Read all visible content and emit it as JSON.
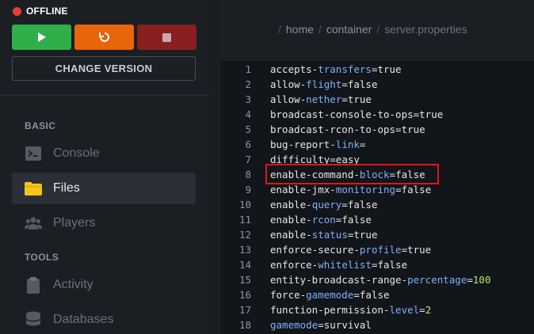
{
  "server": {
    "status": "OFFLINE",
    "status_color": "#e53e3e"
  },
  "power": {
    "start_icon": "play-icon",
    "restart_icon": "restart-icon",
    "stop_icon": "stop-icon"
  },
  "change_version_label": "CHANGE VERSION",
  "sidebar": {
    "sections": [
      {
        "title": "BASIC",
        "items": [
          {
            "label": "Console",
            "icon": "terminal-icon",
            "active": false
          },
          {
            "label": "Files",
            "icon": "folder-icon",
            "active": true
          },
          {
            "label": "Players",
            "icon": "users-icon",
            "active": false
          }
        ]
      },
      {
        "title": "TOOLS",
        "items": [
          {
            "label": "Activity",
            "icon": "clipboard-icon",
            "active": false
          },
          {
            "label": "Databases",
            "icon": "database-icon",
            "active": false
          }
        ]
      }
    ]
  },
  "breadcrumb": [
    "home",
    "container",
    "server.properties"
  ],
  "file_lines": [
    {
      "n": "1",
      "key_parts": [
        [
          "accepts",
          false
        ],
        [
          "-",
          false
        ],
        [
          "transfers",
          true
        ]
      ],
      "value": "true",
      "num": false
    },
    {
      "n": "2",
      "key_parts": [
        [
          "allow",
          false
        ],
        [
          "-",
          false
        ],
        [
          "flight",
          true
        ]
      ],
      "value": "false",
      "num": false
    },
    {
      "n": "3",
      "key_parts": [
        [
          "allow",
          false
        ],
        [
          "-",
          false
        ],
        [
          "nether",
          true
        ]
      ],
      "value": "true",
      "num": false
    },
    {
      "n": "4",
      "key_parts": [
        [
          "broadcast-console-to-ops",
          false
        ]
      ],
      "value": "true",
      "num": false
    },
    {
      "n": "5",
      "key_parts": [
        [
          "broadcast-rcon-to-ops",
          false
        ]
      ],
      "value": "true",
      "num": false
    },
    {
      "n": "6",
      "key_parts": [
        [
          "bug-report-",
          false
        ],
        [
          "link",
          true
        ]
      ],
      "value": "",
      "num": false
    },
    {
      "n": "7",
      "key_parts": [
        [
          "difficulty",
          false
        ]
      ],
      "value": "easy",
      "num": false
    },
    {
      "n": "8",
      "key_parts": [
        [
          "enable-command-",
          false
        ],
        [
          "block",
          true
        ]
      ],
      "value": "false",
      "num": false
    },
    {
      "n": "9",
      "key_parts": [
        [
          "enable-jmx-",
          false
        ],
        [
          "monitoring",
          true
        ]
      ],
      "value": "false",
      "num": false
    },
    {
      "n": "10",
      "key_parts": [
        [
          "enable-",
          false
        ],
        [
          "query",
          true
        ]
      ],
      "value": "false",
      "num": false
    },
    {
      "n": "11",
      "key_parts": [
        [
          "enable-",
          false
        ],
        [
          "rcon",
          true
        ]
      ],
      "value": "false",
      "num": false
    },
    {
      "n": "12",
      "key_parts": [
        [
          "enable-",
          false
        ],
        [
          "status",
          true
        ]
      ],
      "value": "true",
      "num": false
    },
    {
      "n": "13",
      "key_parts": [
        [
          "enforce-secure-",
          false
        ],
        [
          "profile",
          true
        ]
      ],
      "value": "true",
      "num": false
    },
    {
      "n": "14",
      "key_parts": [
        [
          "enforce-",
          false
        ],
        [
          "whitelist",
          true
        ]
      ],
      "value": "false",
      "num": false
    },
    {
      "n": "15",
      "key_parts": [
        [
          "entity-broadcast-range-",
          false
        ],
        [
          "percentage",
          true
        ]
      ],
      "value": "100",
      "num": true
    },
    {
      "n": "16",
      "key_parts": [
        [
          "force-",
          false
        ],
        [
          "gamemode",
          true
        ]
      ],
      "value": "false",
      "num": false
    },
    {
      "n": "17",
      "key_parts": [
        [
          "function-permission-",
          false
        ],
        [
          "level",
          true
        ]
      ],
      "value": "2",
      "num": true
    },
    {
      "n": "18",
      "key_parts": [
        [
          "gamemode",
          true
        ]
      ],
      "value": "survival",
      "num": false
    }
  ],
  "highlighted_line": "8",
  "colors": {
    "start": "#2fae4a",
    "restart": "#e8650c",
    "stop": "#8a1f1f",
    "highlight": "#e01616",
    "key_highlight": "#7fb0ff",
    "number": "#b9e27a"
  }
}
